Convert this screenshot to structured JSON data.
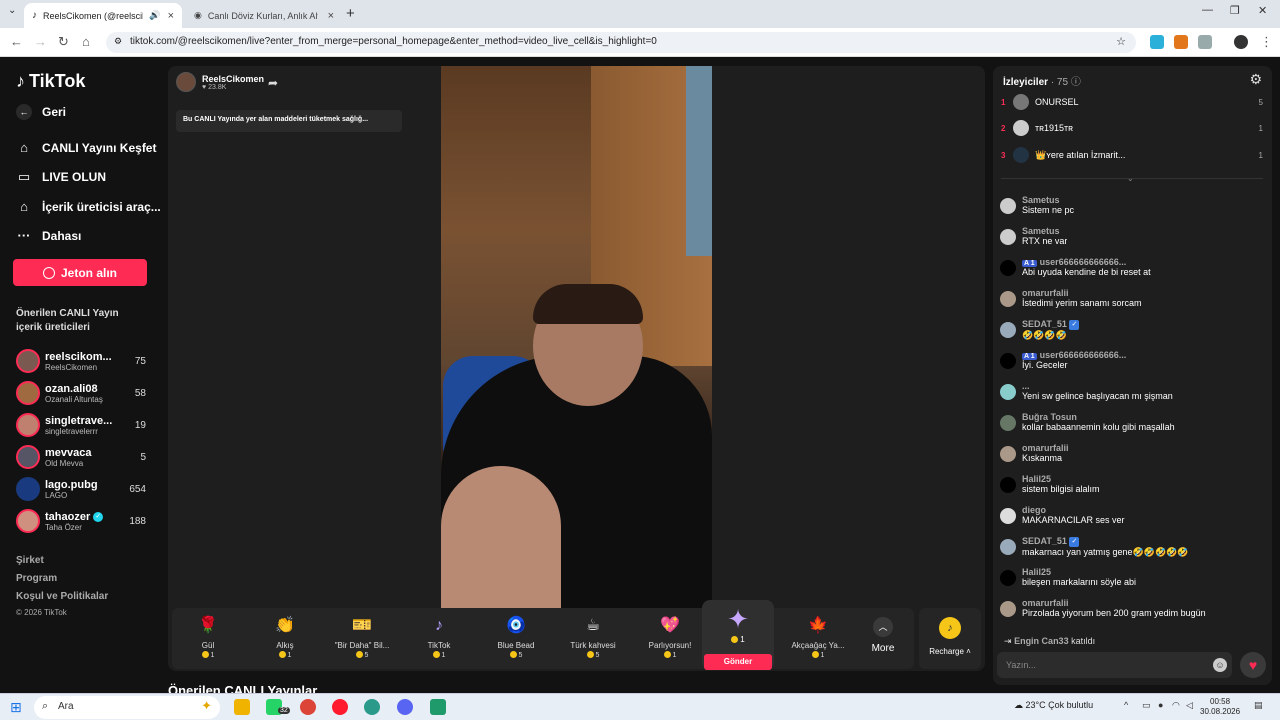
{
  "browser": {
    "tabs": [
      {
        "title": "ReelsCikomen (@reelscikom",
        "active": true
      },
      {
        "title": "Canlı Döviz Kurları, Anlık Altın F",
        "active": false
      }
    ],
    "url": "tiktok.com/@reelscikomen/live?enter_from_merge=personal_homepage&enter_method=video_live_cell&is_highlight=0"
  },
  "sidebar": {
    "logo": "TikTok",
    "back_label": "Geri",
    "nav": [
      {
        "label": "CANLI Yayını Keşfet",
        "icon": "live-explore-icon"
      },
      {
        "label": "LIVE OLUN",
        "icon": "camera-icon"
      },
      {
        "label": "İçerik üreticisi araç...",
        "icon": "creator-tools-icon"
      },
      {
        "label": "Dahası",
        "icon": "more-dots-icon"
      }
    ],
    "jeton_label": "Jeton alın",
    "suggested_title": "Önerilen CANLI Yayın içerik üreticileri",
    "creators": [
      {
        "name": "reelscikom...",
        "sub": "ReelsCikomen",
        "count": "75"
      },
      {
        "name": "ozan.ali08",
        "sub": "Ozanali Altuntaş",
        "count": "58"
      },
      {
        "name": "singletrave...",
        "sub": "singletravelerrr",
        "count": "19"
      },
      {
        "name": "mevvaca",
        "sub": "Old Mevva",
        "count": "5"
      },
      {
        "name": "lago.pubg",
        "sub": "LAGO",
        "count": "654"
      },
      {
        "name": "tahaozer",
        "sub": "Taha Özer",
        "count": "188"
      }
    ],
    "footer": [
      "Şirket",
      "Program",
      "Koşul ve Politikalar",
      "© 2026 TikTok"
    ]
  },
  "stream": {
    "streamer_name": "ReelsCikomen",
    "likes": "23.8K",
    "notice": "Bu CANLI Yayında yer alan maddeleri tüketmek sağlığ..."
  },
  "gifts": [
    {
      "name": "Gül",
      "price": "1",
      "icon": "🌹"
    },
    {
      "name": "Alkış",
      "price": "1",
      "icon": "👏"
    },
    {
      "name": "\"Bir Daha\" Bil...",
      "price": "5",
      "icon": "🎫"
    },
    {
      "name": "TikTok",
      "price": "1",
      "icon": "♪"
    },
    {
      "name": "Blue Bead",
      "price": "5",
      "icon": "🧿"
    },
    {
      "name": "Türk kahvesi",
      "price": "5",
      "icon": "☕"
    },
    {
      "name": "Parlıyorsun!",
      "price": "1",
      "icon": "💖"
    }
  ],
  "featured_gift": {
    "price": "1",
    "send_label": "Gönder",
    "icon": "✦"
  },
  "gift_after": {
    "name": "Akçaağaç Ya...",
    "price": "1",
    "icon": "🍁"
  },
  "more_label": "More",
  "recharge_label": "Recharge",
  "suggested_live_title": "Önerilen CANLI Yayınlar",
  "viewers": {
    "title": "İzleyiciler",
    "count": "75",
    "ranking": [
      {
        "rank": "1",
        "name": "ONURSEL",
        "value": "5"
      },
      {
        "rank": "2",
        "name": "ᴛʀ1915ᴛʀ",
        "value": "1"
      },
      {
        "rank": "3",
        "name": "👑ʏere atılan İzmarit...",
        "value": "1"
      }
    ]
  },
  "chat": [
    {
      "user": "Sametus",
      "text": "Sistem ne pc",
      "level": ""
    },
    {
      "user": "Sametus",
      "text": "RTX ne var",
      "level": ""
    },
    {
      "user": "user666666666666...",
      "text": "Abi uyuda kendine de bi reset at",
      "level": "1"
    },
    {
      "user": "omarurfalii",
      "text": "İstedimi yerim sanamı sorcam",
      "level": ""
    },
    {
      "user": "SEDAT_51",
      "text": "🤣🤣🤣🤣",
      "level": ""
    },
    {
      "user": "user666666666666...",
      "text": "İyi. Geceler",
      "level": "1"
    },
    {
      "user": "...",
      "text": "Yeni sw gelince başlıyacan mı şişman",
      "level": ""
    },
    {
      "user": "Buğra Tosun",
      "text": "kollar babaannemin kolu gibi maşallah",
      "level": ""
    },
    {
      "user": "omarurfalii",
      "text": "Kıskanma",
      "level": ""
    },
    {
      "user": "Halil25",
      "text": "sistem bilgisi alalım",
      "level": ""
    },
    {
      "user": "diego",
      "text": "MAKARNACILAR ses ver",
      "level": ""
    },
    {
      "user": "SEDAT_51",
      "text": "makarnacı yan yatmış gene🤣🤣🤣🤣🤣",
      "level": ""
    },
    {
      "user": "Halil25",
      "text": "bileşen markalarını söyle abi",
      "level": ""
    },
    {
      "user": "omarurfalii",
      "text": "Pirzolada yiyorum ben 200 gram yedim bugün",
      "level": ""
    }
  ],
  "joined": {
    "user": "Engin Can33",
    "text": "katıldı"
  },
  "chat_placeholder": "Yazın...",
  "taskbar": {
    "search": "Ara",
    "weather": "23°C  Çok bulutlu",
    "time": "00:58",
    "date": "30.08.2026",
    "whatsapp_badge": "32"
  },
  "colors": {
    "accent": "#fe2c55",
    "panel": "#1e1e1e",
    "background": "#121212"
  }
}
